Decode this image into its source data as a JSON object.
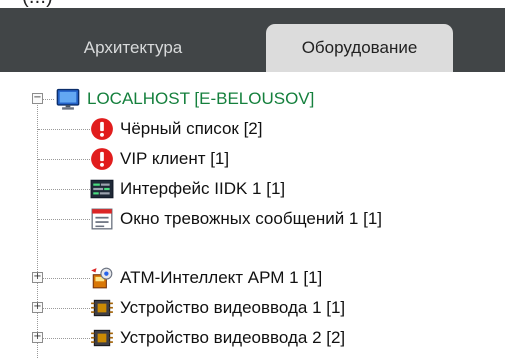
{
  "partial_top_text": "(...)",
  "tabs": [
    {
      "label": "Архитектура",
      "active": false
    },
    {
      "label": "Оборудование",
      "active": true
    }
  ],
  "tree": {
    "root": {
      "label": "LOCALHOST [E-BELOUSOV]",
      "icon": "computer-monitor-icon",
      "expanded": true
    },
    "items": [
      {
        "label": "Чёрный список [2]",
        "icon": "red-alert-icon",
        "expandable": false
      },
      {
        "label": "VIP клиент [1]",
        "icon": "red-alert-icon",
        "expandable": false
      },
      {
        "label": "Интерфейс IIDK 1 [1]",
        "icon": "terminal-interface-icon",
        "expandable": false
      },
      {
        "label": "Окно тревожных сообщений 1 [1]",
        "icon": "alarm-window-icon",
        "expandable": false
      },
      {
        "label": "ATM-Интеллект АРМ 1 [1]",
        "icon": "atm-intellect-icon",
        "expandable": true
      },
      {
        "label": "Устройство видеоввода 1 [1]",
        "icon": "video-capture-chip-icon",
        "expandable": true
      },
      {
        "label": "Устройство видеоввода 2 [2]",
        "icon": "video-capture-chip-icon",
        "expandable": true
      }
    ]
  },
  "colors": {
    "tabbar_bg": "#414547",
    "active_tab_bg": "#dcdcdc",
    "root_label": "#15803d",
    "alert_red": "#e11d1d"
  }
}
